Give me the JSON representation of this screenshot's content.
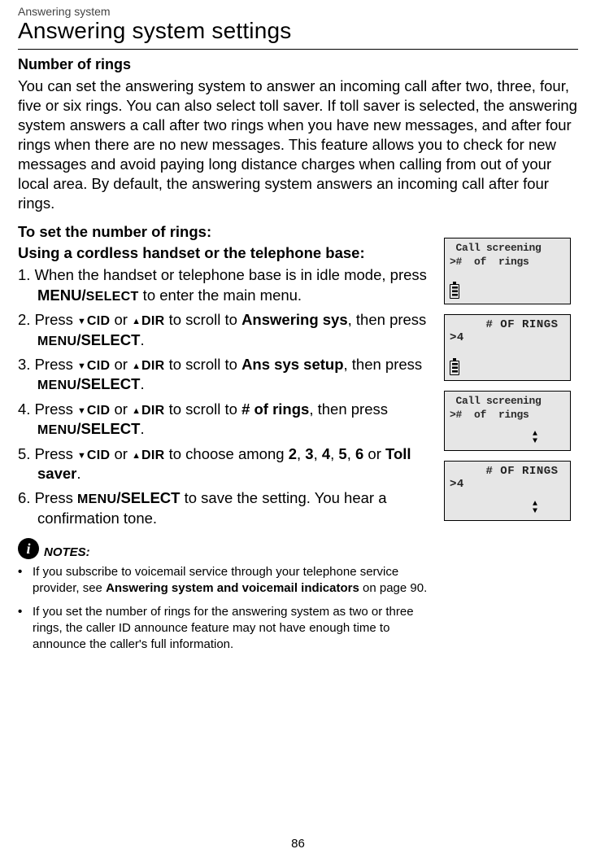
{
  "breadcrumb": "Answering system",
  "title": "Answering system settings",
  "section_heading": "Number of rings",
  "intro": "You can set the answering system to answer an incoming call after two, three, four, five or six rings. You can also select toll saver. If toll saver is selected, the answering system answers a call after two rings when you have new messages, and after four rings when there are no new messages. This feature allows you to check for new messages and avoid paying long distance charges when calling from out of your local area. By default, the answering system answers an incoming call after four rings.",
  "subheading1": "To set the number of rings:",
  "subheading2": "Using a cordless handset or the telephone base:",
  "steps": {
    "s1_a": "When the handset or telephone base is in idle mode, press ",
    "s1_b": "MENU/",
    "s1_c": "SELECT",
    "s1_d": " to enter the main menu.",
    "s2_a": "Press ",
    "s2_cid": "CID",
    "s2_or": " or ",
    "s2_dir": "DIR",
    "s2_b": " to scroll to ",
    "s2_target": "Answering sys",
    "s2_c": ", then press ",
    "s2_menu": "MENU",
    "s2_select": "/SELECT",
    "s2_end": ".",
    "s3_target": "Ans sys setup",
    "s4_target": "# of rings",
    "s5_a": "Press ",
    "s5_b": " to choose among ",
    "s5_opts": [
      "2",
      "3",
      "4",
      "5",
      "6"
    ],
    "s5_or": " or ",
    "s5_toll": "Toll saver",
    "s5_end": ".",
    "s6_a": "Press ",
    "s6_b": " to save the setting. You hear a confirmation tone."
  },
  "notes_label": "NOTES:",
  "notes": {
    "n1_a": "If you subscribe to voicemail service through your telephone service provider, see ",
    "n1_b": "Answering system and voicemail indicators",
    "n1_c": " on page 90.",
    "n2": "If you set the number of rings for the answering system as two or three rings, the caller ID announce feature may not have enough time to announce the caller's full information."
  },
  "lcds": {
    "a_line1": " Call screening",
    "a_line2": ">#  of  rings",
    "b_line1": "     # OF RINGS",
    "b_line2": ">4",
    "c_line1": " Call screening",
    "c_line2": ">#  of  rings",
    "d_line1": "     # OF RINGS",
    "d_line2": ">4"
  },
  "page_number": "86"
}
